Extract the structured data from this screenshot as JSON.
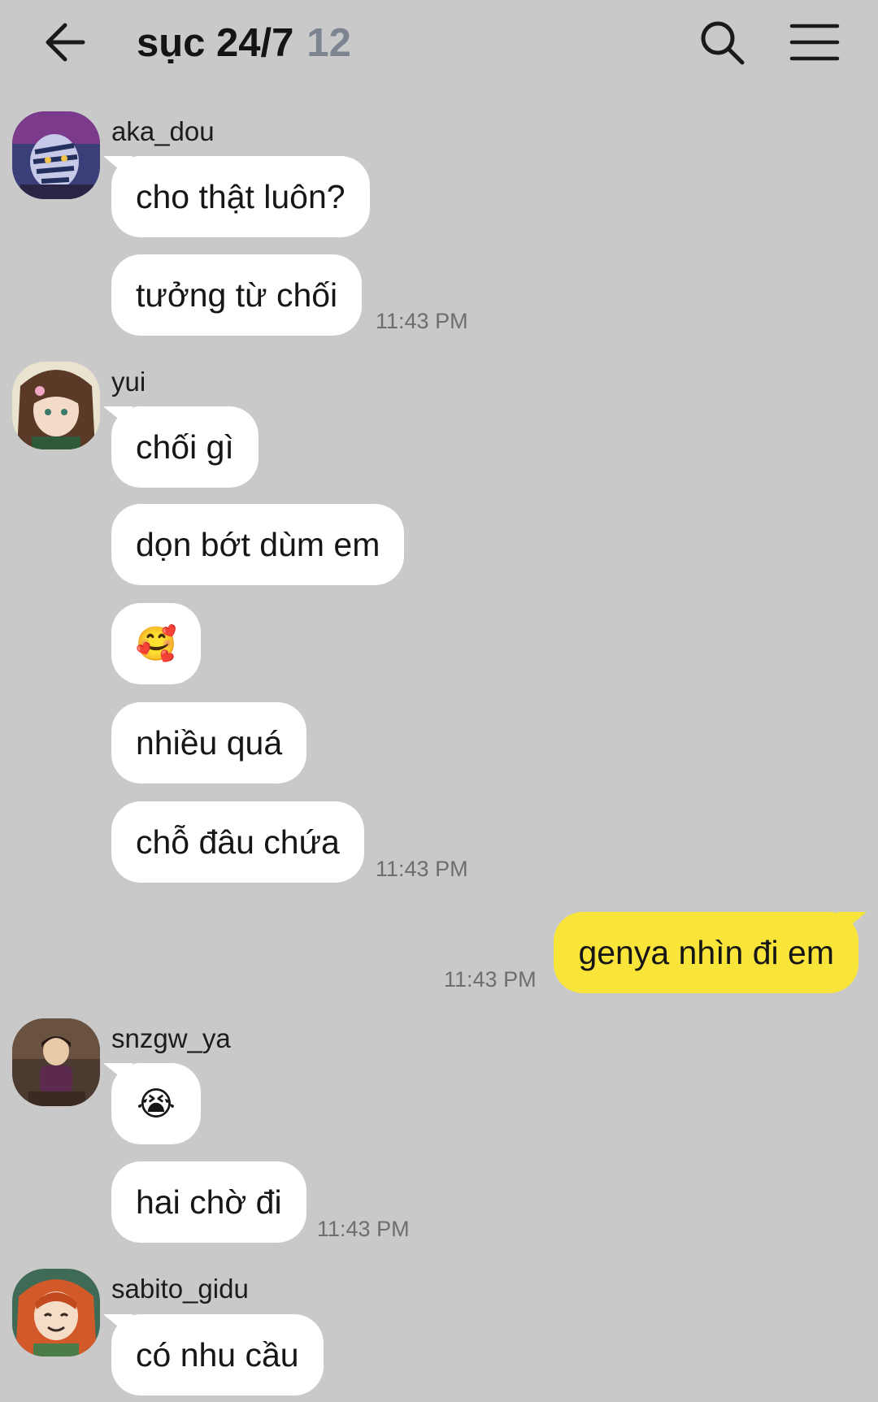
{
  "header": {
    "title": "sục 24/7",
    "member_count": "12"
  },
  "messages": [
    {
      "sender": "aka_dou",
      "bubbles": [
        "cho thật luôn?",
        "tưởng từ chối"
      ],
      "time": "11:43 PM"
    },
    {
      "sender": "yui",
      "bubbles": [
        "chối gì",
        "dọn bớt dùm em",
        "🥰",
        "nhiều quá",
        "chỗ đâu chứa"
      ],
      "time": "11:43 PM"
    },
    {
      "sender": "me",
      "bubbles": [
        "genya nhìn đi em"
      ],
      "time": "11:43 PM"
    },
    {
      "sender": "snzgw_ya",
      "bubbles": [
        "😭",
        "hai chờ đi"
      ],
      "time": "11:43 PM"
    },
    {
      "sender": "sabito_gidu",
      "bubbles": [
        "có nhu cầu"
      ]
    }
  ],
  "colors": {
    "background": "#c9c9c9",
    "incoming_bubble": "#ffffff",
    "outgoing_bubble": "#f9e53a",
    "count": "#7b8490"
  },
  "icons": {
    "back": "arrow-left-icon",
    "search": "search-icon",
    "menu": "hamburger-menu-icon"
  }
}
